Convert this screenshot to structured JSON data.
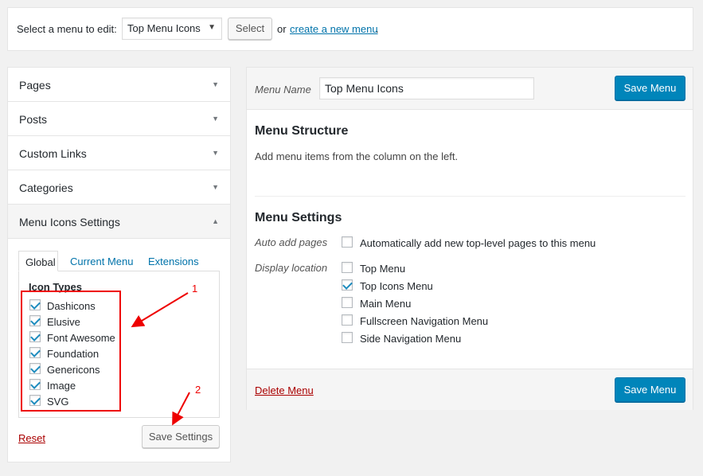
{
  "topbar": {
    "label": "Select a menu to edit:",
    "selected_menu": "Top Menu Icons",
    "select_button": "Select",
    "or_text": "or",
    "create_link": "create a new menu",
    "period": "."
  },
  "sidebar": {
    "items": [
      {
        "label": "Pages",
        "expanded": false
      },
      {
        "label": "Posts",
        "expanded": false
      },
      {
        "label": "Custom Links",
        "expanded": false
      },
      {
        "label": "Categories",
        "expanded": false
      },
      {
        "label": "Menu Icons Settings",
        "expanded": true
      }
    ],
    "tabs": [
      "Global",
      "Current Menu",
      "Extensions"
    ],
    "icon_types_heading": "Icon Types",
    "icon_types": [
      {
        "label": "Dashicons",
        "checked": true
      },
      {
        "label": "Elusive",
        "checked": true
      },
      {
        "label": "Font Awesome",
        "checked": true
      },
      {
        "label": "Foundation",
        "checked": true
      },
      {
        "label": "Genericons",
        "checked": true
      },
      {
        "label": "Image",
        "checked": true
      },
      {
        "label": "SVG",
        "checked": true
      }
    ],
    "reset_link": "Reset",
    "save_settings": "Save Settings"
  },
  "annotations": {
    "marker_1": "1",
    "marker_2": "2",
    "color": "#e00000"
  },
  "editor": {
    "menu_name_label": "Menu Name",
    "menu_name_value": "Top Menu Icons",
    "save_menu": "Save Menu",
    "structure_heading": "Menu Structure",
    "structure_hint": "Add menu items from the column on the left.",
    "settings_heading": "Menu Settings",
    "auto_add_label": "Auto add pages",
    "auto_add_option": {
      "label": "Automatically add new top-level pages to this menu",
      "checked": false
    },
    "display_location_label": "Display location",
    "locations": [
      {
        "label": "Top Menu",
        "checked": false
      },
      {
        "label": "Top Icons Menu",
        "checked": true
      },
      {
        "label": "Main Menu",
        "checked": false
      },
      {
        "label": "Fullscreen Navigation Menu",
        "checked": false
      },
      {
        "label": "Side Navigation Menu",
        "checked": false
      }
    ],
    "delete_link": "Delete Menu",
    "save_menu_bottom": "Save Menu"
  },
  "colors": {
    "primary": "#0085ba",
    "link": "#0073aa",
    "delete": "#aa0000",
    "check": "#1e8cbe"
  }
}
